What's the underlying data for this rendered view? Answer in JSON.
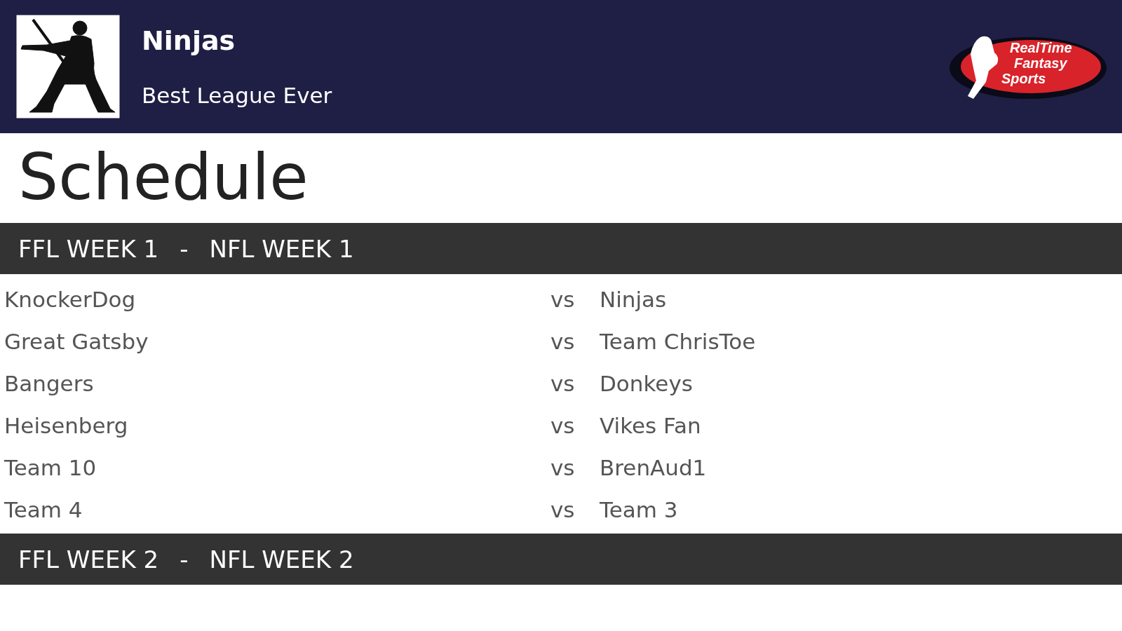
{
  "header": {
    "team_name": "Ninjas",
    "league_name": "Best League Ever",
    "logo": {
      "lines": [
        "RealTime",
        "Fantasy",
        "Sports"
      ]
    }
  },
  "page_title": "Schedule",
  "weeks": [
    {
      "ffl": "FFL WEEK 1",
      "separator": "-",
      "nfl": "NFL WEEK 1",
      "matchups": [
        {
          "home": "KnockerDog",
          "vs": "vs",
          "away": "Ninjas"
        },
        {
          "home": "Great Gatsby",
          "vs": "vs",
          "away": "Team ChrisToe"
        },
        {
          "home": "Bangers",
          "vs": "vs",
          "away": "Donkeys"
        },
        {
          "home": "Heisenberg",
          "vs": "vs",
          "away": "Vikes Fan"
        },
        {
          "home": "Team 10",
          "vs": "vs",
          "away": "BrenAud1"
        },
        {
          "home": "Team 4",
          "vs": "vs",
          "away": "Team 3"
        }
      ]
    },
    {
      "ffl": "FFL WEEK 2",
      "separator": "-",
      "nfl": "NFL WEEK 2"
    }
  ]
}
